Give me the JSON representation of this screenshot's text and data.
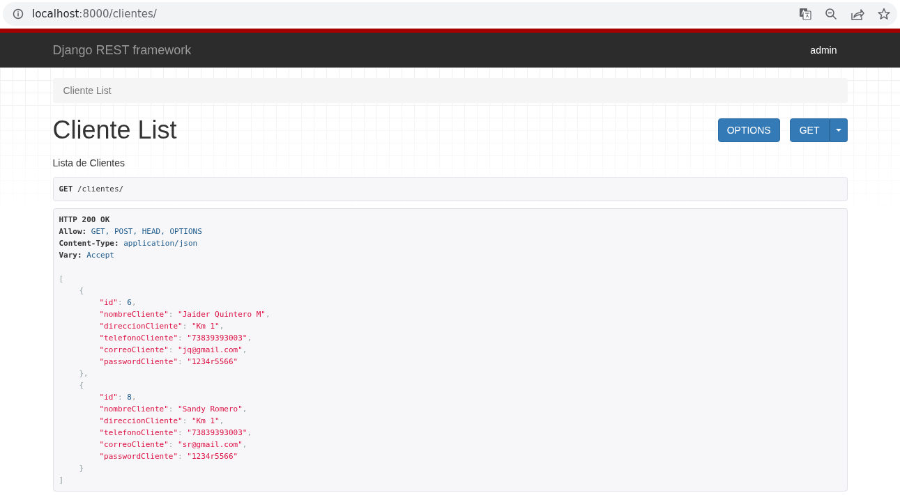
{
  "browser": {
    "url_host": "localhost",
    "url_path": ":8000/clientes/"
  },
  "navbar": {
    "brand": "Django REST framework",
    "user": "admin"
  },
  "breadcrumb": {
    "items": [
      {
        "label": "Cliente List"
      }
    ]
  },
  "heading": "Cliente List",
  "buttons": [
    {
      "label": "OPTIONS",
      "kind": "plain"
    },
    {
      "label": "GET",
      "kind": "split"
    }
  ],
  "description": "Lista de Clientes",
  "request": {
    "method": "GET",
    "path": "/clientes/"
  },
  "response": {
    "status": "HTTP 200 OK",
    "header_sep": ": ",
    "headers": [
      {
        "name": "Allow",
        "value": "GET, POST, HEAD, OPTIONS"
      },
      {
        "name": "Content-Type",
        "value": "application/json"
      },
      {
        "name": "Vary",
        "value": "Accept"
      }
    ],
    "body": {
      "open": "[",
      "close": "]",
      "item_open": "{",
      "item_close": "}",
      "item_sep": ",",
      "key_sep": ": ",
      "field_sep": ",",
      "items": [
        {
          "fields": [
            {
              "key": "\"id\"",
              "value": "6",
              "kind": "number"
            },
            {
              "key": "\"nombreCliente\"",
              "value": "\"Jaider Quintero M\"",
              "kind": "string"
            },
            {
              "key": "\"direccionCliente\"",
              "value": "\"Km 1\"",
              "kind": "string"
            },
            {
              "key": "\"telefonoCliente\"",
              "value": "\"73839393003\"",
              "kind": "string"
            },
            {
              "key": "\"correoCliente\"",
              "value": "\"jq@gmail.com\"",
              "kind": "string"
            },
            {
              "key": "\"passwordCliente\"",
              "value": "\"1234r5566\"",
              "kind": "string"
            }
          ]
        },
        {
          "fields": [
            {
              "key": "\"id\"",
              "value": "8",
              "kind": "number"
            },
            {
              "key": "\"nombreCliente\"",
              "value": "\"Sandy Romero\"",
              "kind": "string"
            },
            {
              "key": "\"direccionCliente\"",
              "value": "\"Km 1\"",
              "kind": "string"
            },
            {
              "key": "\"telefonoCliente\"",
              "value": "\"73839393003\"",
              "kind": "string"
            },
            {
              "key": "\"correoCliente\"",
              "value": "\"sr@gmail.com\"",
              "kind": "string"
            },
            {
              "key": "\"passwordCliente\"",
              "value": "\"1234r5566\"",
              "kind": "string"
            }
          ]
        }
      ]
    }
  }
}
